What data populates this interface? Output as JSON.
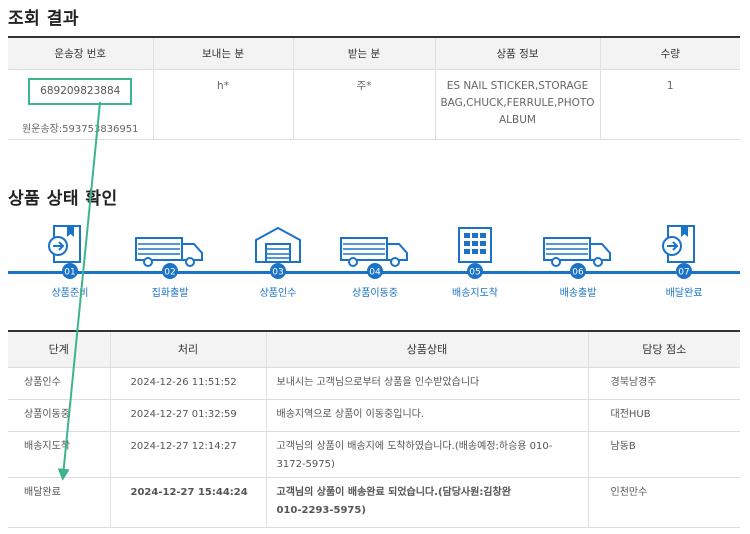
{
  "result": {
    "title": "조회 결과",
    "headers": [
      "운송장 번호",
      "보내는 분",
      "받는 분",
      "상품 정보",
      "수량"
    ],
    "tracking_no": "689209823884",
    "original_label": "원운송장:593753836951",
    "sender": "h*",
    "receiver": "주*",
    "product_line1": "ES NAIL STICKER,STORAGE",
    "product_line2": "BAG,CHUCK,FERRULE,PHOTO",
    "product_line3": "ALBUM",
    "qty": "1"
  },
  "status": {
    "title": "상품 상태 확인",
    "steps": [
      {
        "num": "01",
        "label": "상품준비",
        "icon": "box-arrow-icon"
      },
      {
        "num": "02",
        "label": "집화출발",
        "icon": "truck-icon"
      },
      {
        "num": "03",
        "label": "상품인수",
        "icon": "warehouse-icon"
      },
      {
        "num": "04",
        "label": "상품이동중",
        "icon": "truck-icon"
      },
      {
        "num": "05",
        "label": "배송지도착",
        "icon": "building-icon"
      },
      {
        "num": "06",
        "label": "배송출발",
        "icon": "truck-icon"
      },
      {
        "num": "07",
        "label": "배달완료",
        "icon": "box-arrow-icon"
      }
    ],
    "accent_color": "#1a73c7"
  },
  "detail": {
    "headers": [
      "단계",
      "처리",
      "상품상태",
      "담당 점소"
    ],
    "rows": [
      {
        "stage": "상품인수",
        "time": "2024-12-26 11:51:52",
        "status_line1": "보내시는 고객님으로부터 상품을 인수받았습니다",
        "status_line2": "",
        "office": "경북남경주"
      },
      {
        "stage": "상품이동중",
        "time": "2024-12-27 01:32:59",
        "status_line1": "배송지역으로 상품이 이동중입니다.",
        "status_line2": "",
        "office": "대전HUB"
      },
      {
        "stage": "배송지도착",
        "time": "2024-12-27 12:14:27",
        "status_line1": "고객님의 상품이 배송지에 도착하였습니다.(배송예정:하승용 010-",
        "status_line2": "3172-5975)",
        "office": "남동B"
      },
      {
        "stage": "배달완료",
        "time": "2024-12-27 15:44:24",
        "status_line1": "고객님의 상품이 배송완료 되었습니다.(담당사원:김창완",
        "status_line2": "010-2293-5975)",
        "office": "인천만수"
      }
    ]
  },
  "annotation_color": "#3bb58b"
}
